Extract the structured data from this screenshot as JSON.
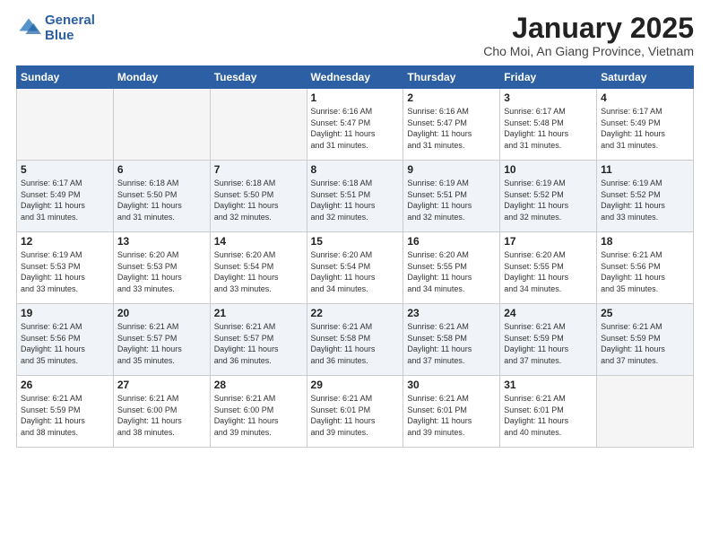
{
  "logo": {
    "line1": "General",
    "line2": "Blue"
  },
  "title": "January 2025",
  "subtitle": "Cho Moi, An Giang Province, Vietnam",
  "weekdays": [
    "Sunday",
    "Monday",
    "Tuesday",
    "Wednesday",
    "Thursday",
    "Friday",
    "Saturday"
  ],
  "weeks": [
    [
      {
        "day": "",
        "info": ""
      },
      {
        "day": "",
        "info": ""
      },
      {
        "day": "",
        "info": ""
      },
      {
        "day": "1",
        "info": "Sunrise: 6:16 AM\nSunset: 5:47 PM\nDaylight: 11 hours\nand 31 minutes."
      },
      {
        "day": "2",
        "info": "Sunrise: 6:16 AM\nSunset: 5:47 PM\nDaylight: 11 hours\nand 31 minutes."
      },
      {
        "day": "3",
        "info": "Sunrise: 6:17 AM\nSunset: 5:48 PM\nDaylight: 11 hours\nand 31 minutes."
      },
      {
        "day": "4",
        "info": "Sunrise: 6:17 AM\nSunset: 5:49 PM\nDaylight: 11 hours\nand 31 minutes."
      }
    ],
    [
      {
        "day": "5",
        "info": "Sunrise: 6:17 AM\nSunset: 5:49 PM\nDaylight: 11 hours\nand 31 minutes."
      },
      {
        "day": "6",
        "info": "Sunrise: 6:18 AM\nSunset: 5:50 PM\nDaylight: 11 hours\nand 31 minutes."
      },
      {
        "day": "7",
        "info": "Sunrise: 6:18 AM\nSunset: 5:50 PM\nDaylight: 11 hours\nand 32 minutes."
      },
      {
        "day": "8",
        "info": "Sunrise: 6:18 AM\nSunset: 5:51 PM\nDaylight: 11 hours\nand 32 minutes."
      },
      {
        "day": "9",
        "info": "Sunrise: 6:19 AM\nSunset: 5:51 PM\nDaylight: 11 hours\nand 32 minutes."
      },
      {
        "day": "10",
        "info": "Sunrise: 6:19 AM\nSunset: 5:52 PM\nDaylight: 11 hours\nand 32 minutes."
      },
      {
        "day": "11",
        "info": "Sunrise: 6:19 AM\nSunset: 5:52 PM\nDaylight: 11 hours\nand 33 minutes."
      }
    ],
    [
      {
        "day": "12",
        "info": "Sunrise: 6:19 AM\nSunset: 5:53 PM\nDaylight: 11 hours\nand 33 minutes."
      },
      {
        "day": "13",
        "info": "Sunrise: 6:20 AM\nSunset: 5:53 PM\nDaylight: 11 hours\nand 33 minutes."
      },
      {
        "day": "14",
        "info": "Sunrise: 6:20 AM\nSunset: 5:54 PM\nDaylight: 11 hours\nand 33 minutes."
      },
      {
        "day": "15",
        "info": "Sunrise: 6:20 AM\nSunset: 5:54 PM\nDaylight: 11 hours\nand 34 minutes."
      },
      {
        "day": "16",
        "info": "Sunrise: 6:20 AM\nSunset: 5:55 PM\nDaylight: 11 hours\nand 34 minutes."
      },
      {
        "day": "17",
        "info": "Sunrise: 6:20 AM\nSunset: 5:55 PM\nDaylight: 11 hours\nand 34 minutes."
      },
      {
        "day": "18",
        "info": "Sunrise: 6:21 AM\nSunset: 5:56 PM\nDaylight: 11 hours\nand 35 minutes."
      }
    ],
    [
      {
        "day": "19",
        "info": "Sunrise: 6:21 AM\nSunset: 5:56 PM\nDaylight: 11 hours\nand 35 minutes."
      },
      {
        "day": "20",
        "info": "Sunrise: 6:21 AM\nSunset: 5:57 PM\nDaylight: 11 hours\nand 35 minutes."
      },
      {
        "day": "21",
        "info": "Sunrise: 6:21 AM\nSunset: 5:57 PM\nDaylight: 11 hours\nand 36 minutes."
      },
      {
        "day": "22",
        "info": "Sunrise: 6:21 AM\nSunset: 5:58 PM\nDaylight: 11 hours\nand 36 minutes."
      },
      {
        "day": "23",
        "info": "Sunrise: 6:21 AM\nSunset: 5:58 PM\nDaylight: 11 hours\nand 37 minutes."
      },
      {
        "day": "24",
        "info": "Sunrise: 6:21 AM\nSunset: 5:59 PM\nDaylight: 11 hours\nand 37 minutes."
      },
      {
        "day": "25",
        "info": "Sunrise: 6:21 AM\nSunset: 5:59 PM\nDaylight: 11 hours\nand 37 minutes."
      }
    ],
    [
      {
        "day": "26",
        "info": "Sunrise: 6:21 AM\nSunset: 5:59 PM\nDaylight: 11 hours\nand 38 minutes."
      },
      {
        "day": "27",
        "info": "Sunrise: 6:21 AM\nSunset: 6:00 PM\nDaylight: 11 hours\nand 38 minutes."
      },
      {
        "day": "28",
        "info": "Sunrise: 6:21 AM\nSunset: 6:00 PM\nDaylight: 11 hours\nand 39 minutes."
      },
      {
        "day": "29",
        "info": "Sunrise: 6:21 AM\nSunset: 6:01 PM\nDaylight: 11 hours\nand 39 minutes."
      },
      {
        "day": "30",
        "info": "Sunrise: 6:21 AM\nSunset: 6:01 PM\nDaylight: 11 hours\nand 39 minutes."
      },
      {
        "day": "31",
        "info": "Sunrise: 6:21 AM\nSunset: 6:01 PM\nDaylight: 11 hours\nand 40 minutes."
      },
      {
        "day": "",
        "info": ""
      }
    ]
  ]
}
